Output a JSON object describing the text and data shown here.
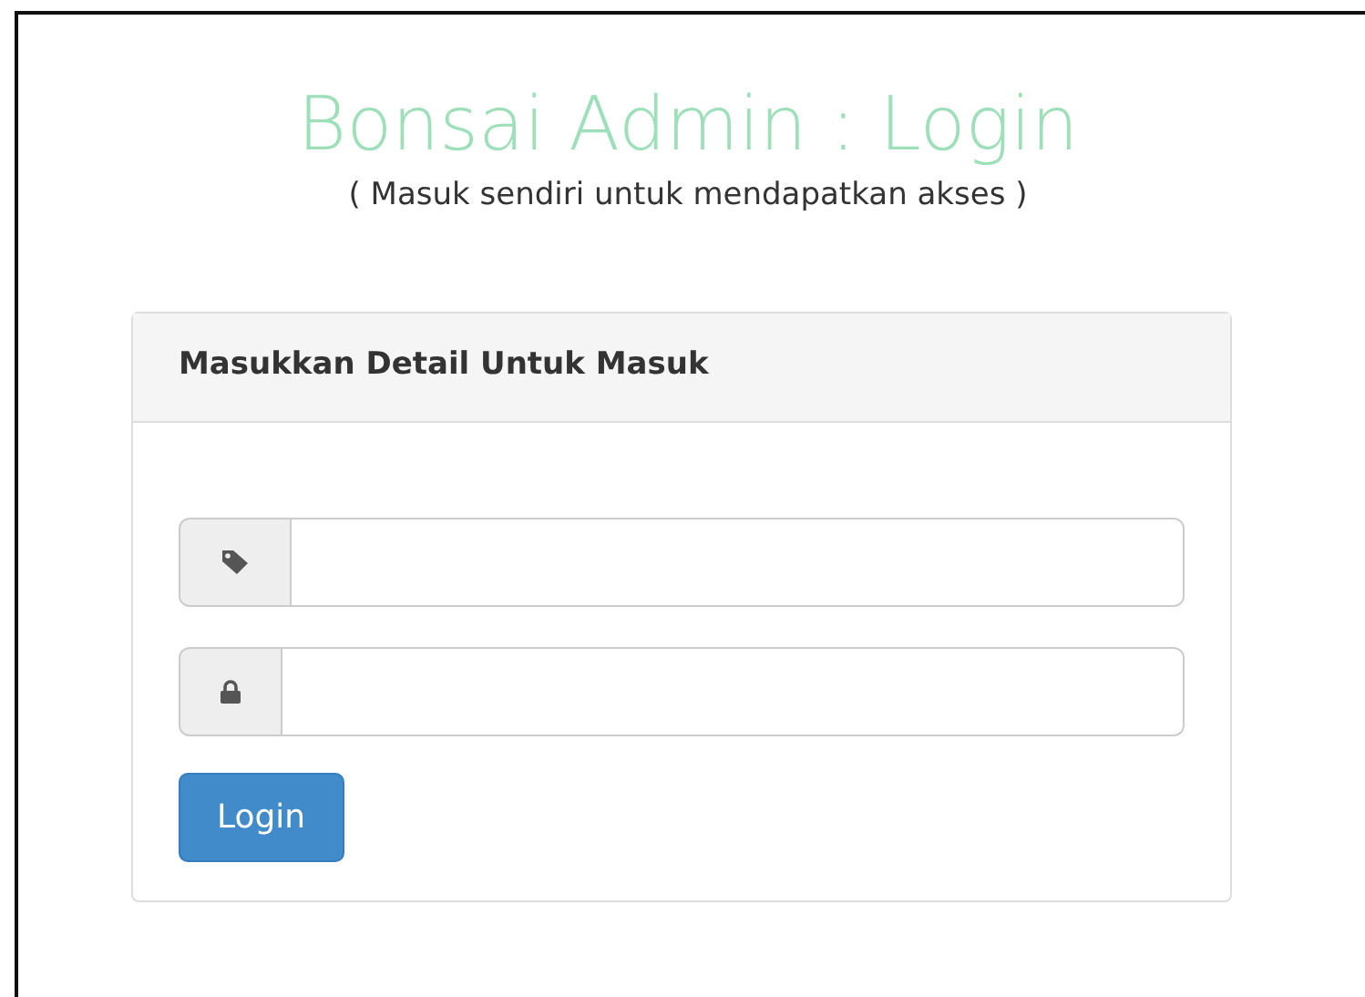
{
  "header": {
    "title": "Bonsai Admin : Login",
    "subtitle": "( Masuk sendiri untuk mendapatkan akses )"
  },
  "panel": {
    "heading": "Masukkan Detail Untuk Masuk",
    "fields": [
      {
        "kind": "username"
      },
      {
        "kind": "password"
      }
    ],
    "button": "Login"
  }
}
